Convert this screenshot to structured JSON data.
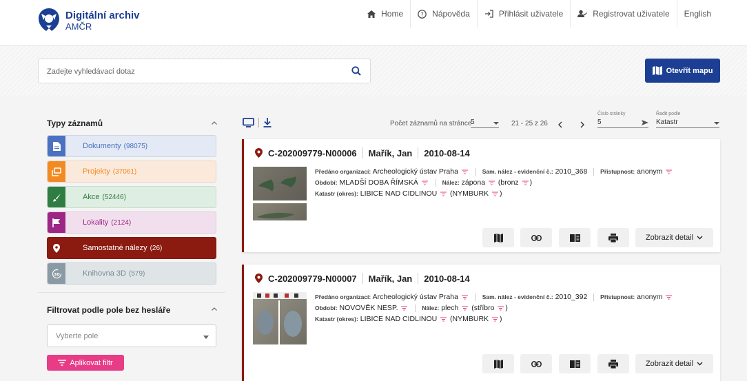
{
  "brand": {
    "title": "Digitální archiv",
    "subtitle": "AMČR"
  },
  "nav": {
    "home": "Home",
    "help": "Nápověda",
    "login": "Přihlásit uživatele",
    "register": "Registrovat uživatele",
    "language": "English"
  },
  "search": {
    "placeholder": "Zadejte vyhledávací dotaz",
    "map_button": "Otevřít mapu"
  },
  "sidebar": {
    "record_types_title": "Typy záznamů",
    "record_types": [
      {
        "label": "Dokumenty",
        "count": "(98075)",
        "color": "#4a72c0",
        "bg": "#e3e9f5",
        "text": "#4a72c0",
        "icon": "document-icon"
      },
      {
        "label": "Projekty",
        "count": "(37061)",
        "color": "#f28a23",
        "bg": "#fbeadb",
        "text": "#f28a23",
        "icon": "project-icon"
      },
      {
        "label": "Akce",
        "count": "(52446)",
        "color": "#2f7d43",
        "bg": "#dfeee2",
        "text": "#2f7d43",
        "icon": "brush-icon"
      },
      {
        "label": "Lokality",
        "count": "(2124)",
        "color": "#9c2785",
        "bg": "#f2dfee",
        "text": "#9c2785",
        "icon": "flag-icon"
      },
      {
        "label": "Samostatné nálezy",
        "count": "(26)",
        "color": "#8b1a10",
        "bg": "#8b1a10",
        "text": "#ffffff",
        "icon": "pin-icon"
      },
      {
        "label": "Knihovna 3D",
        "count": "(579)",
        "color": "#8a9aa4",
        "bg": "#dfe4e7",
        "text": "#7a8a94",
        "icon": "3d-icon"
      }
    ],
    "filter_title": "Filtrovat podle pole bez hesláře",
    "filter_select_placeholder": "Vyberte pole",
    "apply_filter": "Aplikovat filtr"
  },
  "toolbar": {
    "per_page_label": "Počet záznamů na stránce",
    "per_page_value": "5",
    "range": "21 - 25 z 26",
    "page_label": "Číslo stránky",
    "page_value": "5",
    "sort_label": "Řadit podle",
    "sort_value": "Katastr"
  },
  "cards": [
    {
      "id": "C-202009779-N00006",
      "author": "Mařík, Jan",
      "date": "2010-08-14",
      "org_label": "Předáno organizací:",
      "org": "Archeologický ústav Praha",
      "sam_label": "Sam. nález - evidenční č.:",
      "sam": "2010_368",
      "access_label": "Přístupnost:",
      "access": "anonym",
      "period_label": "Období:",
      "period": "MLADŠÍ DOBA ŘÍMSKÁ",
      "find_label": "Nález:",
      "find": "zápona",
      "material": "(bronz",
      "katastr_label": "Katastr (okres):",
      "katastr": "LIBICE NAD CIDLINOU",
      "okres": "(NYMBURK",
      "detail": "Zobrazit detail"
    },
    {
      "id": "C-202009779-N00007",
      "author": "Mařík, Jan",
      "date": "2010-08-14",
      "org_label": "Předáno organizací:",
      "org": "Archeologický ústav Praha",
      "sam_label": "Sam. nález - evidenční č.:",
      "sam": "2010_392",
      "access_label": "Přístupnost:",
      "access": "anonym",
      "period_label": "Období:",
      "period": "NOVOVĚK NESP.",
      "find_label": "Nález:",
      "find": "plech",
      "material": "(stříbro",
      "katastr_label": "Katastr (okres):",
      "katastr": "LIBICE NAD CIDLINOU",
      "okres": "(NYMBURK",
      "detail": "Zobrazit detail"
    }
  ],
  "close_paren": ")",
  "colors": {
    "brand": "#1c3f93",
    "accent": "#e83c86",
    "record": "#8b1a10"
  }
}
